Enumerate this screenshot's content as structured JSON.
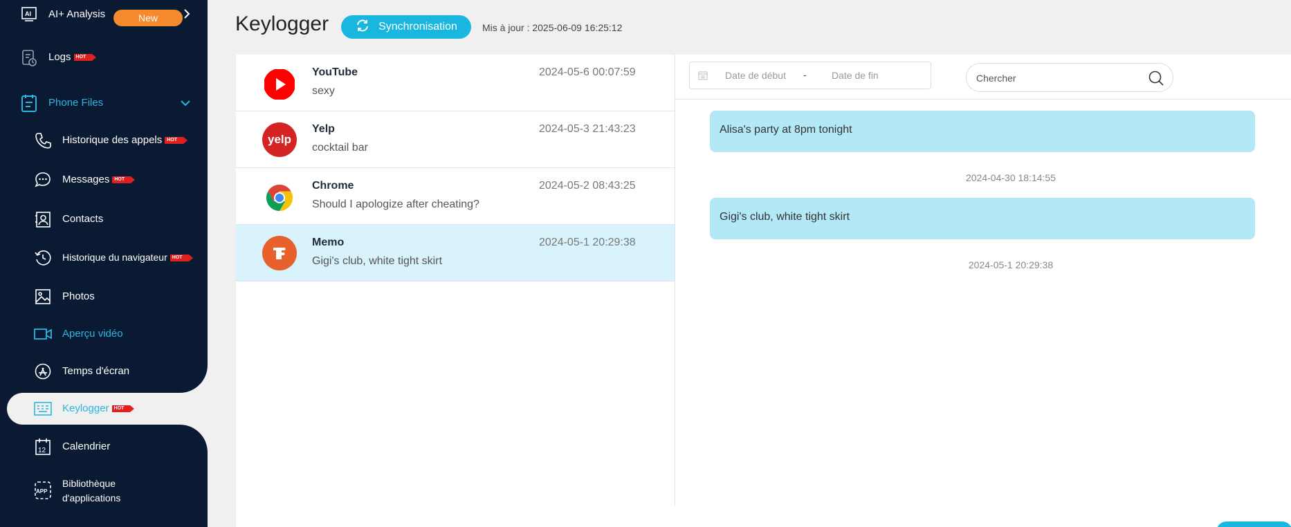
{
  "sidebar": {
    "ai_analysis": {
      "label": "AI+ Analysis",
      "badge": "New"
    },
    "logs": {
      "label": "Logs",
      "hot": "HOT"
    },
    "phone_files": {
      "label": "Phone Files"
    },
    "items": [
      {
        "label": "Historique des appels",
        "hot": "HOT"
      },
      {
        "label": "Messages",
        "hot": "HOT"
      },
      {
        "label": "Contacts"
      },
      {
        "label": "Historique du navigateur",
        "hot": "HOT"
      },
      {
        "label": "Photos"
      },
      {
        "label": "Aperçu vidéo"
      },
      {
        "label": "Temps d'écran"
      },
      {
        "label": "Keylogger",
        "hot": "HOT"
      },
      {
        "label": "Calendrier"
      },
      {
        "label_line1": "Bibliothèque",
        "label_line2": "d'applications"
      }
    ]
  },
  "header": {
    "title": "Keylogger",
    "sync_label": "Synchronisation",
    "updated": "Mis à jour : 2025-06-09 16:25:12"
  },
  "list": [
    {
      "app": "YouTube",
      "text": "sexy",
      "time": "2024-05-6 00:07:59",
      "icon": "youtube-icon"
    },
    {
      "app": "Yelp",
      "text": "cocktail bar",
      "time": "2024-05-3 21:43:23",
      "icon": "yelp-icon",
      "icon_text": "yelp"
    },
    {
      "app": "Chrome",
      "text": "Should I apologize after cheating?",
      "time": "2024-05-2 08:43:25",
      "icon": "chrome-icon"
    },
    {
      "app": "Memo",
      "text": "Gigi's club, white tight skirt",
      "time": "2024-05-1 20:29:38",
      "icon": "memo-icon"
    }
  ],
  "filter": {
    "date_start_placeholder": "Date de début",
    "date_separator": "-",
    "date_end_placeholder": "Date de fin",
    "search_placeholder": "Chercher"
  },
  "detail": [
    {
      "text": "Alisa's party at 8pm tonight",
      "time": "2024-04-30 18:14:55"
    },
    {
      "text": "Gigi's club, white tight skirt",
      "time": "2024-05-1 20:29:38"
    }
  ],
  "colors": {
    "sidebar_bg": "#0b1a33",
    "accent": "#19b7df",
    "selected_row": "#d8f3fb",
    "bubble": "#b3e8f6",
    "badge_new": "#f4892e",
    "hot": "#e02020"
  }
}
